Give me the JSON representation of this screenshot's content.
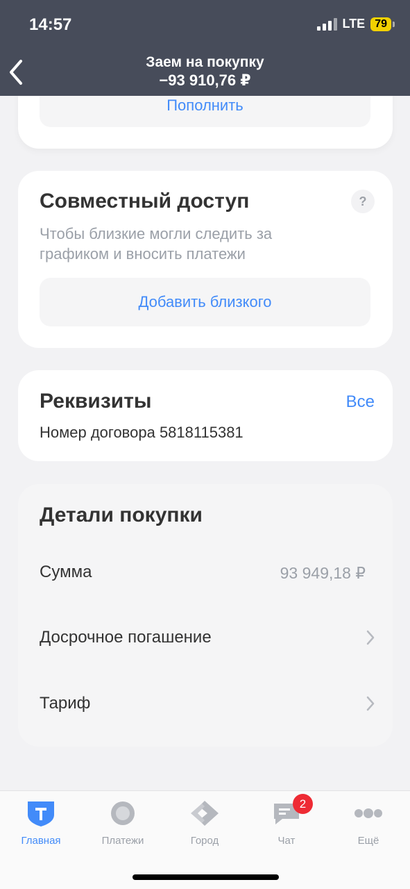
{
  "status": {
    "time": "14:57",
    "network": "LTE",
    "battery": "79"
  },
  "header": {
    "title": "Заем на покупку",
    "amount": "−93 910,76 ₽"
  },
  "topup": {
    "label": "Пополнить"
  },
  "access": {
    "title": "Совместный доступ",
    "help": "?",
    "description": "Чтобы близкие могли следить за графиком и вносить платежи",
    "add_label": "Добавить близкого"
  },
  "requisites": {
    "title": "Реквизиты",
    "all_label": "Все",
    "contract": "Номер договора 5818115381"
  },
  "details": {
    "title": "Детали покупки",
    "sum_label": "Сумма",
    "sum_value": "93 949,18 ₽",
    "early_label": "Досрочное погашение",
    "tariff_label": "Тариф"
  },
  "tabs": [
    {
      "label": "Главная",
      "icon": "shield-icon"
    },
    {
      "label": "Платежи",
      "icon": "payments-icon"
    },
    {
      "label": "Город",
      "icon": "city-icon"
    },
    {
      "label": "Чат",
      "icon": "chat-icon",
      "badge": "2"
    },
    {
      "label": "Ещё",
      "icon": "more-icon"
    }
  ],
  "colors": {
    "accent": "#428bf9",
    "header_bg": "#474c5a",
    "badge": "#ee2b34",
    "battery": "#f2d100"
  }
}
